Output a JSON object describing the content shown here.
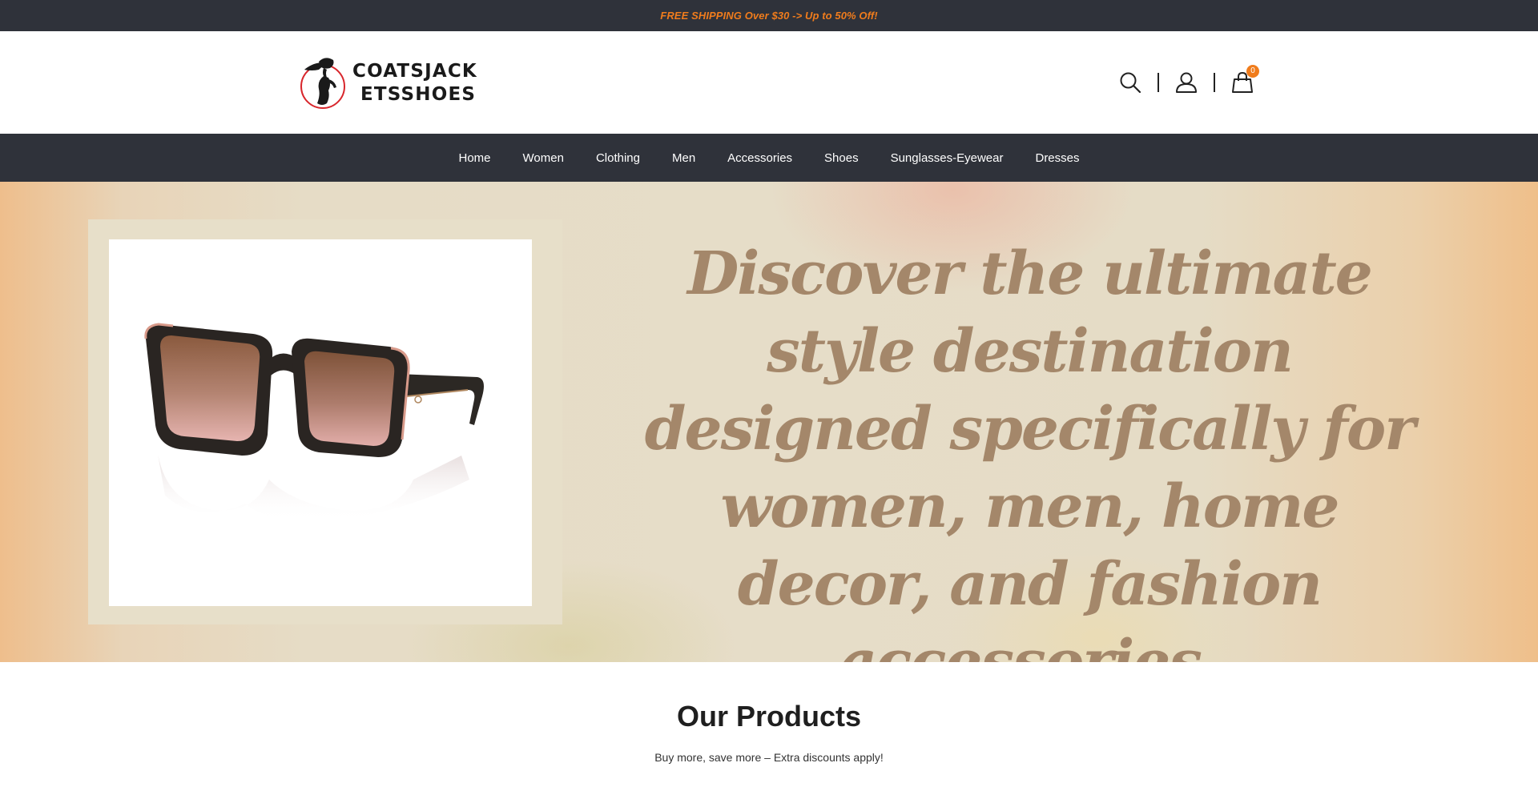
{
  "announcement": {
    "text": "FREE SHIPPING Over $30 -> Up to 50% Off!"
  },
  "header": {
    "logo": {
      "line1": "COATSJACK",
      "line2": "ETSSHOES"
    },
    "icons": {
      "search": "search-icon",
      "account": "user-icon",
      "cart": "shopping-bag-icon"
    },
    "cart_count": "0"
  },
  "nav": {
    "items": [
      {
        "label": "Home"
      },
      {
        "label": "Women"
      },
      {
        "label": "Clothing"
      },
      {
        "label": "Men"
      },
      {
        "label": "Accessories"
      },
      {
        "label": "Shoes"
      },
      {
        "label": "Sunglasses-Eyewear"
      },
      {
        "label": "Dresses"
      }
    ]
  },
  "hero": {
    "headline": "Discover the ultimate style destination designed specifically for women, men, home decor, and fashion accessories."
  },
  "products": {
    "title": "Our Products",
    "subtitle": "Buy more, save more – Extra discounts apply!"
  },
  "colors": {
    "bar_bg": "#2f323a",
    "accent": "#f07c1c",
    "headline": "#a4876a"
  }
}
